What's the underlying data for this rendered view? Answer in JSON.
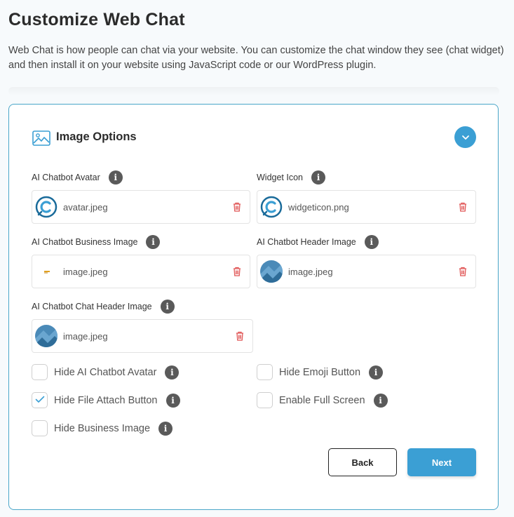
{
  "page": {
    "title": "Customize Web Chat",
    "description": "Web Chat is how people can chat via your website. You can customize the chat window they see (chat widget) and then install it on your website using JavaScript code or our WordPress plugin."
  },
  "card": {
    "title": "Image Options",
    "icon": "image-icon",
    "collapse_icon": "chevron-down-icon"
  },
  "fields": {
    "avatar": {
      "label": "AI Chatbot Avatar",
      "file": "avatar.jpeg",
      "thumb": "chatbot-logo"
    },
    "widget_icon": {
      "label": "Widget Icon",
      "file": "widgeticon.png",
      "thumb": "chatbot-logo"
    },
    "business_image": {
      "label": "AI Chatbot Business Image",
      "file": "image.jpeg",
      "thumb": "small-logo"
    },
    "header_image": {
      "label": "AI Chatbot Header Image",
      "file": "image.jpeg",
      "thumb": "photo"
    },
    "chat_header_image": {
      "label": "AI Chatbot Chat Header Image",
      "file": "image.jpeg",
      "thumb": "photo"
    }
  },
  "options": {
    "hide_avatar": {
      "label": "Hide AI Chatbot Avatar",
      "checked": false
    },
    "hide_emoji": {
      "label": "Hide Emoji Button",
      "checked": false
    },
    "hide_file_attach": {
      "label": "Hide File Attach Button",
      "checked": true
    },
    "full_screen": {
      "label": "Enable Full Screen",
      "checked": false
    },
    "hide_business_image": {
      "label": "Hide Business Image",
      "checked": false
    }
  },
  "buttons": {
    "back": "Back",
    "next": "Next"
  },
  "colors": {
    "accent": "#3b9fd4",
    "border": "#4aa6c8",
    "trash": "#e05555"
  }
}
